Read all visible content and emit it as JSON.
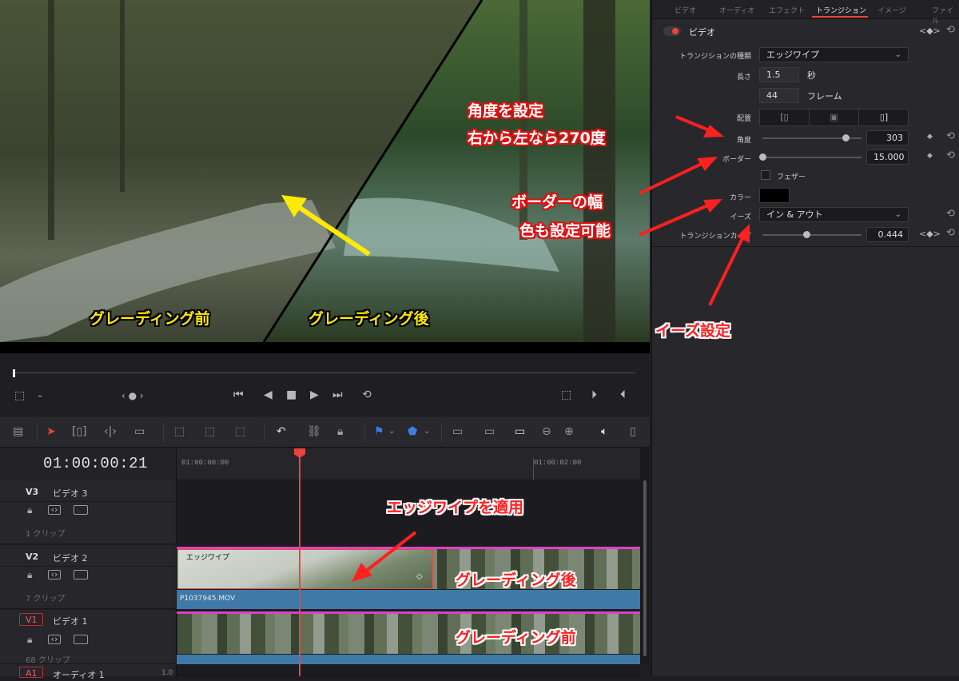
{
  "viewer": {
    "label_before": "グレーディング前",
    "label_after": "グレーディング後"
  },
  "transport": {
    "scrub_position": 0.01
  },
  "timeline": {
    "timecode": "01:00:00:21",
    "ruler": [
      "01:00:00:00",
      "01:00:02:00"
    ],
    "tracks": [
      {
        "id": "V3",
        "name": "ビデオ 3",
        "count": "1 クリップ"
      },
      {
        "id": "V2",
        "name": "ビデオ 2",
        "count": "7 クリップ"
      },
      {
        "id": "V1",
        "name": "ビデオ 1",
        "count": "68 クリップ"
      },
      {
        "id": "A1",
        "name": "オーディオ 1",
        "level": "1.0"
      }
    ],
    "transition_clip_label": "エッジワイプ",
    "audio_clip_label": "P1037945.MOV"
  },
  "inspector": {
    "tabs": [
      "ビデオ",
      "オーディオ",
      "エフェクト",
      "トランジション",
      "イメージ",
      "ファイル"
    ],
    "active_tab": "トランジション",
    "section_title": "ビデオ",
    "transition_type_label": "トランジションの種類",
    "transition_type_value": "エッジワイプ",
    "length_label": "長さ",
    "length_seconds": "1.5",
    "seconds_unit": "秒",
    "length_frames": "44",
    "frames_unit": "フレーム",
    "alignment_label": "配置",
    "angle_label": "角度",
    "angle_value": "303",
    "angle_fraction": 0.84,
    "border_label": "ボーダー",
    "border_value": "15.000",
    "border_fraction": 0.0,
    "feather_label": "フェザー",
    "color_label": "カラー",
    "color_value": "#000000",
    "ease_label": "イーズ",
    "ease_value": "イン & アウト",
    "strength_label": "トランジションカーブ",
    "strength_value": "0.444",
    "strength_fraction": 0.44,
    "keyframe_nav": "<◆>"
  },
  "annotations": {
    "angle_note_1": "角度を設定",
    "angle_note_2": "右から左なら270度",
    "border_note_1": "ボーダーの幅",
    "border_note_2": "色も設定可能",
    "ease_note": "イーズ設定",
    "apply_note": "エッジワイプを適用",
    "v2_note": "グレーディング後",
    "v1_note": "グレーディング前"
  },
  "colors": {
    "accent_red": "#ff2020",
    "playhead": "#e8453c",
    "clip_blue": "#3f79a8",
    "clip_pink": "#e040c8"
  }
}
